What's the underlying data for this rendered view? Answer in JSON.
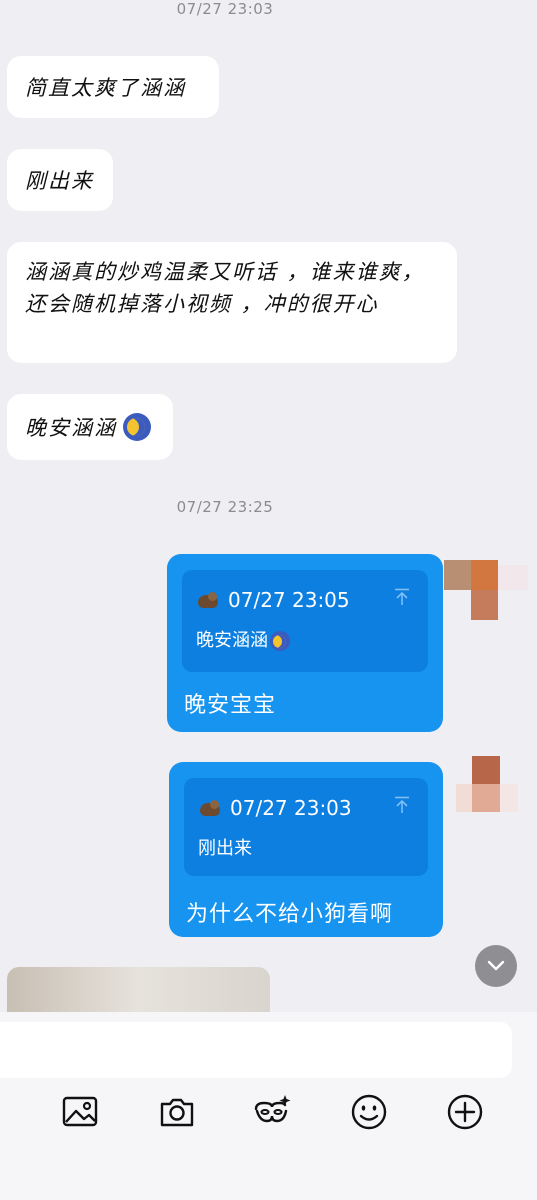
{
  "timestamps": [
    "07/27 23:03",
    "07/27 23:25"
  ],
  "incoming_messages": [
    {
      "text": "简直太爽了涵涵"
    },
    {
      "text": "刚出来"
    },
    {
      "text": "涵涵真的炒鸡温柔又听话 ，谁来谁爽，还会随机掉落小视频 ，冲的很开心"
    },
    {
      "text": "晚安涵涵",
      "emoji": "crescent-moon-emoji"
    }
  ],
  "outgoing_messages": [
    {
      "quote_time": "07/27 23:05",
      "quote_text": "晚安涵涵",
      "quote_emoji": "crescent-moon-emoji",
      "text": "晚安宝宝"
    },
    {
      "quote_time": "07/27 23:03",
      "quote_text": "刚出来",
      "text": "为什么不给小狗看啊"
    }
  ],
  "toolbar": {
    "icons": [
      "image-icon",
      "camera-icon",
      "mask-sparkle-icon",
      "smiley-icon",
      "plus-circle-icon"
    ]
  },
  "colors": {
    "background": "#efeff3",
    "incoming_bubble": "#ffffff",
    "outgoing_bubble": "#1794f0",
    "quote_block": "#0d7fe0"
  }
}
